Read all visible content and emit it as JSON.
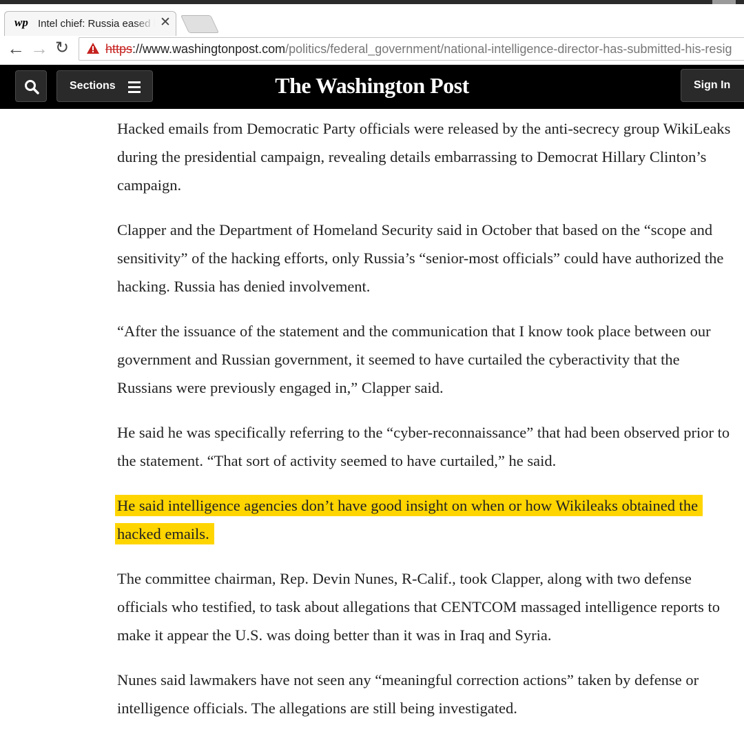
{
  "browser": {
    "tab_title": "Intel chief: Russia eased hacking after statement",
    "favicon_text": "wp",
    "url_scheme": "https",
    "url_host": "://www.washingtonpost.com",
    "url_path": "/politics/federal_government/national-intelligence-director-has-submitted-his-resig"
  },
  "header": {
    "sections_label": "Sections",
    "masthead": "The Washington Post",
    "signin_label": "Sign In"
  },
  "article": {
    "p1": "Hacked emails from Democratic Party officials were released by the anti-secrecy group WikiLeaks during the presidential campaign, revealing details embarrassing to Democrat Hillary Clinton’s campaign.",
    "p2": "Clapper and the Department of Homeland Security said in October that based on the “scope and sensitivity” of the hacking efforts, only Russia’s “senior-most officials” could have authorized the hacking. Russia has denied involvement.",
    "p3": "“After the issuance of the statement and the communication that I know took place between our government and Russian government, it seemed to have curtailed the cyberactivity that the Russians were previously engaged in,” Clapper said.",
    "p4": "He said he was specifically referring to the “cyber-reconnaissance” that had been observed prior to the statement. “That sort of activity seemed to have curtailed,” he said.",
    "p5_highlighted": "He said intelligence agencies don’t have good insight on when or how Wikileaks obtained the hacked emails.",
    "p6": "The committee chairman, Rep. Devin Nunes, R-Calif., took Clapper, along with two defense officials who testified, to task about allegations that CENTCOM massaged intelligence reports to make it appear the U.S. was doing better than it was in Iraq and Syria.",
    "p7": "Nunes said lawmakers have not seen any “meaningful correction actions” taken by defense or intelligence officials. The allegations are still being investigated."
  },
  "colors": {
    "highlight": "#ffd500",
    "header_bg": "#000000",
    "warning": "#c5221f"
  },
  "icons": [
    "wp-favicon-icon",
    "close-icon",
    "back-arrow-icon",
    "forward-arrow-icon",
    "reload-icon",
    "warning-icon",
    "search-icon",
    "hamburger-icon"
  ]
}
